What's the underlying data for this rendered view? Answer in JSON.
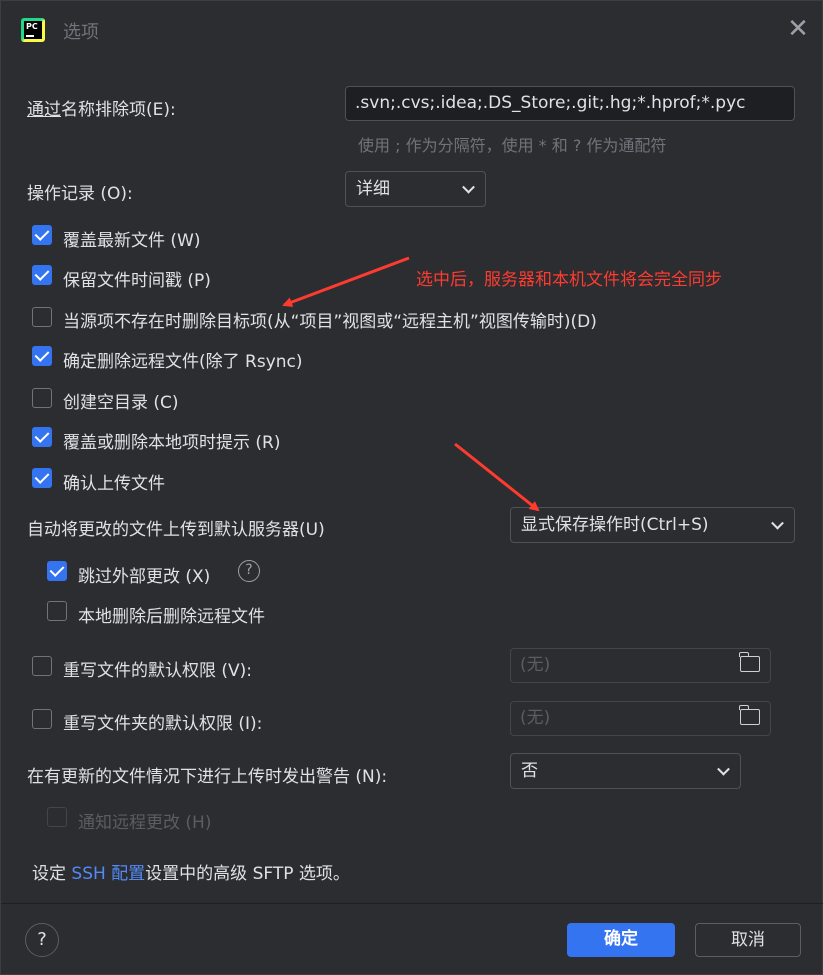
{
  "window": {
    "title": "选项",
    "app_icon_text": "PC"
  },
  "exclude": {
    "label_underlined": "通过",
    "label_rest": "名称排除项(E):",
    "value": ".svn;.cvs;.idea;.DS_Store;.git;.hg;*.hprof;*.pyc",
    "hint": "使用 ; 作为分隔符，使用 * 和 ? 作为通配符"
  },
  "operation_log": {
    "label": "操作记录 (O):",
    "value": "详细"
  },
  "checkboxes": [
    {
      "label": "覆盖最新文件 (W)",
      "checked": true
    },
    {
      "label": "保留文件时间戳 (P)",
      "checked": true
    },
    {
      "label": "当源项不存在时删除目标项(从“项目”视图或“远程主机”视图传输时)(D)",
      "checked": false
    },
    {
      "label": "确定删除远程文件(除了 Rsync)",
      "checked": true
    },
    {
      "label": "创建空目录 (C)",
      "checked": false
    },
    {
      "label": "覆盖或删除本地项时提示 (R)",
      "checked": true
    },
    {
      "label": "确认上传文件",
      "checked": true
    }
  ],
  "auto_upload": {
    "label": "自动将更改的文件上传到默认服务器(U)",
    "value": "显式保存操作时(Ctrl+S)",
    "skip_external": {
      "label": "跳过外部更改 (X)",
      "checked": true
    },
    "delete_remote": {
      "label": "本地删除后删除远程文件",
      "checked": false
    }
  },
  "permissions": {
    "file": {
      "label": "重写文件的默认权限 (V):",
      "value": "(无)",
      "checked": false
    },
    "folder": {
      "label": "重写文件夹的默认权限 (I):",
      "value": "(无)",
      "checked": false
    }
  },
  "warn": {
    "label": "在有更新的文件情况下进行上传时发出警告 (N):",
    "value": "否"
  },
  "notify_remote": {
    "label": "通知远程更改 (H)",
    "checked": false
  },
  "footer_text": {
    "before": "设定 ",
    "link": "SSH 配置",
    "after": "设置中的高级 SFTP 选项。"
  },
  "buttons": {
    "ok": "确定",
    "cancel": "取消",
    "help": "?"
  },
  "annotation": {
    "text": "选中后，服务器和本机文件将会完全同步",
    "color": "#ff3b30"
  },
  "colors": {
    "accent": "#3574f0",
    "background": "#2b2d30",
    "link": "#548af7"
  }
}
